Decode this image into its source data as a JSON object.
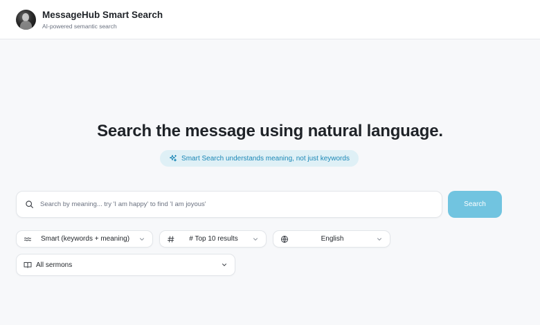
{
  "header": {
    "title": "MessageHub Smart Search",
    "subtitle": "AI-powered semantic search",
    "logo_icon": "avatar-logo"
  },
  "hero": {
    "title": "Search the message using natural language.",
    "badge": "Smart Search understands meaning, not just keywords",
    "badge_icon": "sparkle-icon"
  },
  "search": {
    "placeholder": "Search by meaning... try 'I am happy' to find 'I am joyous'",
    "value": "",
    "button_label": "Search"
  },
  "filters": {
    "mode": {
      "label": "Smart (keywords + meaning)",
      "icon": "waves-icon"
    },
    "count": {
      "label": "# Top 10 results",
      "icon": "hash-icon"
    },
    "language": {
      "label": "English",
      "icon": "globe-icon"
    },
    "scope": {
      "label": "All sermons",
      "icon": "book-icon"
    }
  },
  "colors": {
    "accent": "#71c4e0",
    "badge_bg": "#dff0f6",
    "badge_text": "#1b87b6",
    "page_bg": "#f7f8fa"
  }
}
